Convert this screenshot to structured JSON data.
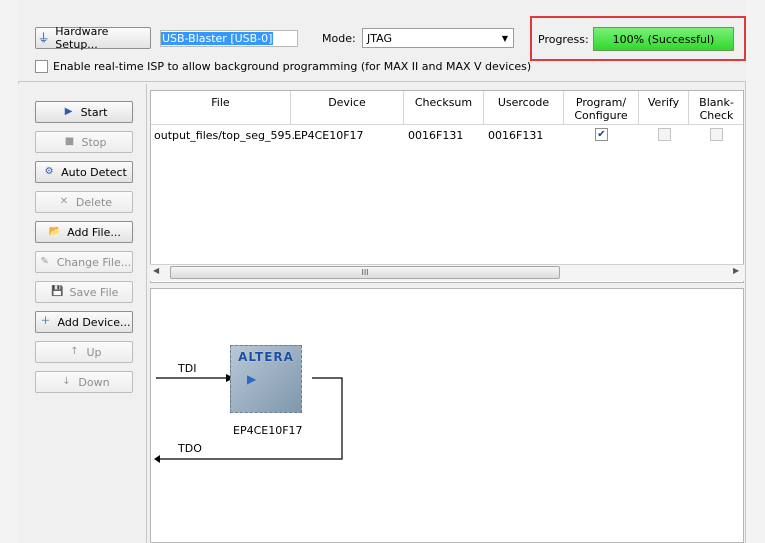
{
  "header": {
    "hardware_setup_label": "Hardware Setup...",
    "hardware_value": "USB-Blaster [USB-0]",
    "mode_label": "Mode:",
    "mode_value": "JTAG",
    "progress_label": "Progress:",
    "progress_text": "100% (Successful)",
    "progress_value": 1.0,
    "progress_color": "#3ddc3a",
    "highlight_color": "#e0393c",
    "isp_checkbox_label": "Enable real-time ISP to allow background programming (for MAX II and MAX V devices)",
    "isp_checked": false
  },
  "sidebar": {
    "buttons": [
      {
        "label": "Start",
        "icon": "play-icon",
        "enabled": true
      },
      {
        "label": "Stop",
        "icon": "stop-icon",
        "enabled": false
      },
      {
        "label": "Auto Detect",
        "icon": "auto-detect-icon",
        "enabled": true
      },
      {
        "label": "Delete",
        "icon": "delete-icon",
        "enabled": false
      },
      {
        "label": "Add File...",
        "icon": "folder-icon",
        "enabled": true
      },
      {
        "label": "Change File...",
        "icon": "change-file-icon",
        "enabled": false
      },
      {
        "label": "Save File",
        "icon": "save-icon",
        "enabled": false
      },
      {
        "label": "Add Device...",
        "icon": "add-device-icon",
        "enabled": true
      },
      {
        "label": "Up",
        "icon": "up-icon",
        "enabled": false
      },
      {
        "label": "Down",
        "icon": "down-icon",
        "enabled": false
      }
    ]
  },
  "table": {
    "columns": [
      "File",
      "Device",
      "Checksum",
      "Usercode",
      "Program/\nConfigure",
      "Verify",
      "Blank-\nCheck"
    ],
    "rows": [
      {
        "file": "output_files/top_seg_595...",
        "device": "EP4CE10F17",
        "checksum": "0016F131",
        "usercode": "0016F131",
        "program": true,
        "verify": false,
        "blank_check": false
      }
    ],
    "scroll_grip": "III"
  },
  "diagram": {
    "chip_logo": "ALTERA",
    "chip_label": "EP4CE10F17",
    "tdi_label": "TDI",
    "tdo_label": "TDO"
  }
}
